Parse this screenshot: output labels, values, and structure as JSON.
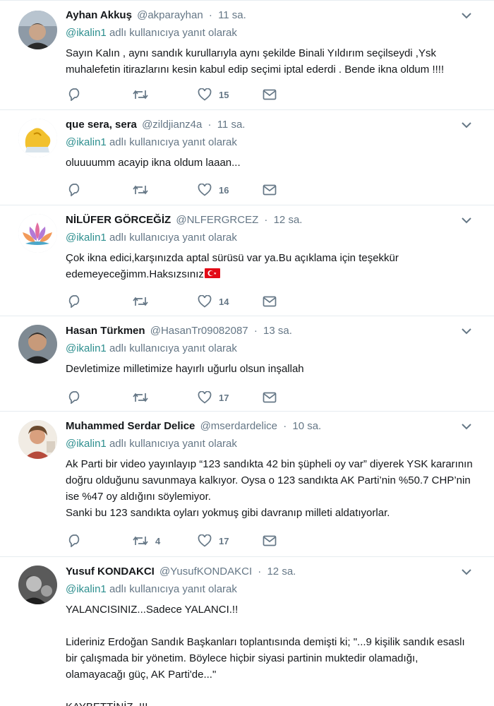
{
  "reply_context_prefix": "",
  "reply_context_suffix": "adlı kullanıcıya yanıt olarak",
  "tweets": [
    {
      "fullname": "Ayhan Akkuş",
      "username": "@akparayhan",
      "time": "11 sa.",
      "mention": "@ikalin1",
      "text": "Sayın Kalın , aynı sandık kurullarıyla aynı şekilde Binali Yıldırım seçilseydi ,Ysk muhalefetin itirazlarını kesin kabul edip seçimi iptal ederdi . Bende ikna oldum !!!!",
      "retweets": "",
      "likes": "15"
    },
    {
      "fullname": "que sera, sera",
      "username": "@zildjianz4a",
      "time": "11 sa.",
      "mention": "@ikalin1",
      "text": "oluuuumm acayip ikna oldum laaan...",
      "retweets": "",
      "likes": "16"
    },
    {
      "fullname": "NİLÜFER GÖRCEĞİZ",
      "username": "@NLFERGRCEZ",
      "time": "12 sa.",
      "mention": "@ikalin1",
      "text": "Çok ikna edici,karşınızda aptal sürüsü var ya.Bu açıklama için teşekkür edemeyeceğimm.Haksızsınız",
      "retweets": "",
      "likes": "14"
    },
    {
      "fullname": "Hasan Türkmen",
      "username": "@HasanTr09082087",
      "time": "13 sa.",
      "mention": "@ikalin1",
      "text": "Devletimize milletimize hayırlı uğurlu olsun inşallah",
      "retweets": "",
      "likes": "17"
    },
    {
      "fullname": "Muhammed Serdar Delice",
      "username": "@mserdardelice",
      "time": "10 sa.",
      "mention": "@ikalin1",
      "text": "Ak Parti bir video yayınlayıp “123 sandıkta 42 bin şüpheli oy var” diyerek YSK kararının doğru olduğunu savunmaya kalkıyor. Oysa o 123 sandıkta AK Parti’nin %50.7 CHP’nin ise %47 oy aldığını söylemiyor.\nSanki bu 123 sandıkta oyları yokmuş gibi davranıp milleti aldatıyorlar.",
      "retweets": "4",
      "likes": "17"
    },
    {
      "fullname": "Yusuf KONDAKCI",
      "username": "@YusufKONDAKCI",
      "time": "12 sa.",
      "mention": "@ikalin1",
      "text": "YALANCISINIZ...Sadece YALANCI.!!\n\nLideriniz Erdoğan Sandık Başkanları toplantısında demişti ki; \"...9 kişilik sandık esaslı bir çalışmada bir yönetim. Böylece hiçbir siyasi partinin muktedir olamadığı, olamayacağı güç, AK Parti'de...\"\n\nKAYBETTİNİZ..!!!",
      "retweets": "",
      "likes": ""
    }
  ],
  "colors": {
    "secondary": "#657786",
    "mention": "#2c8e8e",
    "border": "#e6ecf0"
  },
  "icons": [
    "chevron-down-icon",
    "reply-icon",
    "retweet-icon",
    "like-icon",
    "direct-message-icon",
    "turkish-flag-icon"
  ]
}
